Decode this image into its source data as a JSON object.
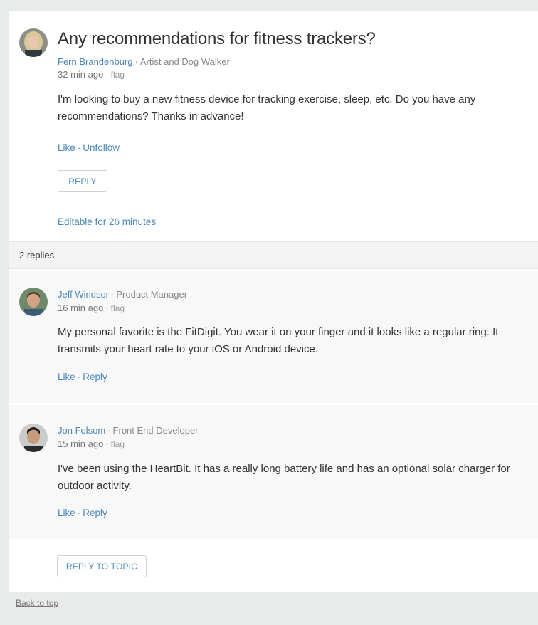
{
  "topic": {
    "title": "Any recommendations for fitness trackers?",
    "author": "Fern Brandenburg",
    "role": "Artist and Dog Walker",
    "time": "32 min ago",
    "flag": "flag",
    "body": "I'm looking to buy a new fitness device for tracking exercise, sleep, etc. Do you have any recommendations? Thanks in advance!",
    "like": "Like",
    "unfollow": "Unfollow",
    "reply_button": "REPLY",
    "editable": "Editable for 26 minutes"
  },
  "replies_count": "2 replies",
  "replies": [
    {
      "author": "Jeff Windsor",
      "role": "Product Manager",
      "time": "16 min ago",
      "flag": "flag",
      "body": "My personal favorite is the FitDigit. You wear it on your finger and it looks like a regular ring. It transmits your heart rate to your iOS or Android device.",
      "like": "Like",
      "reply": "Reply"
    },
    {
      "author": "Jon Folsom",
      "role": "Front End Developer",
      "time": "15 min ago",
      "flag": "flag",
      "body": "I've been using the HeartBit. It has a really long battery life and has an optional solar charger for outdoor activity.",
      "like": "Like",
      "reply": "Reply"
    }
  ],
  "reply_to_topic": "REPLY TO TOPIC",
  "back_to_top": "Back to top",
  "colors": {
    "link": "#4a87b9",
    "background": "#e9eaea",
    "reply_bg": "#f8f8f8"
  }
}
